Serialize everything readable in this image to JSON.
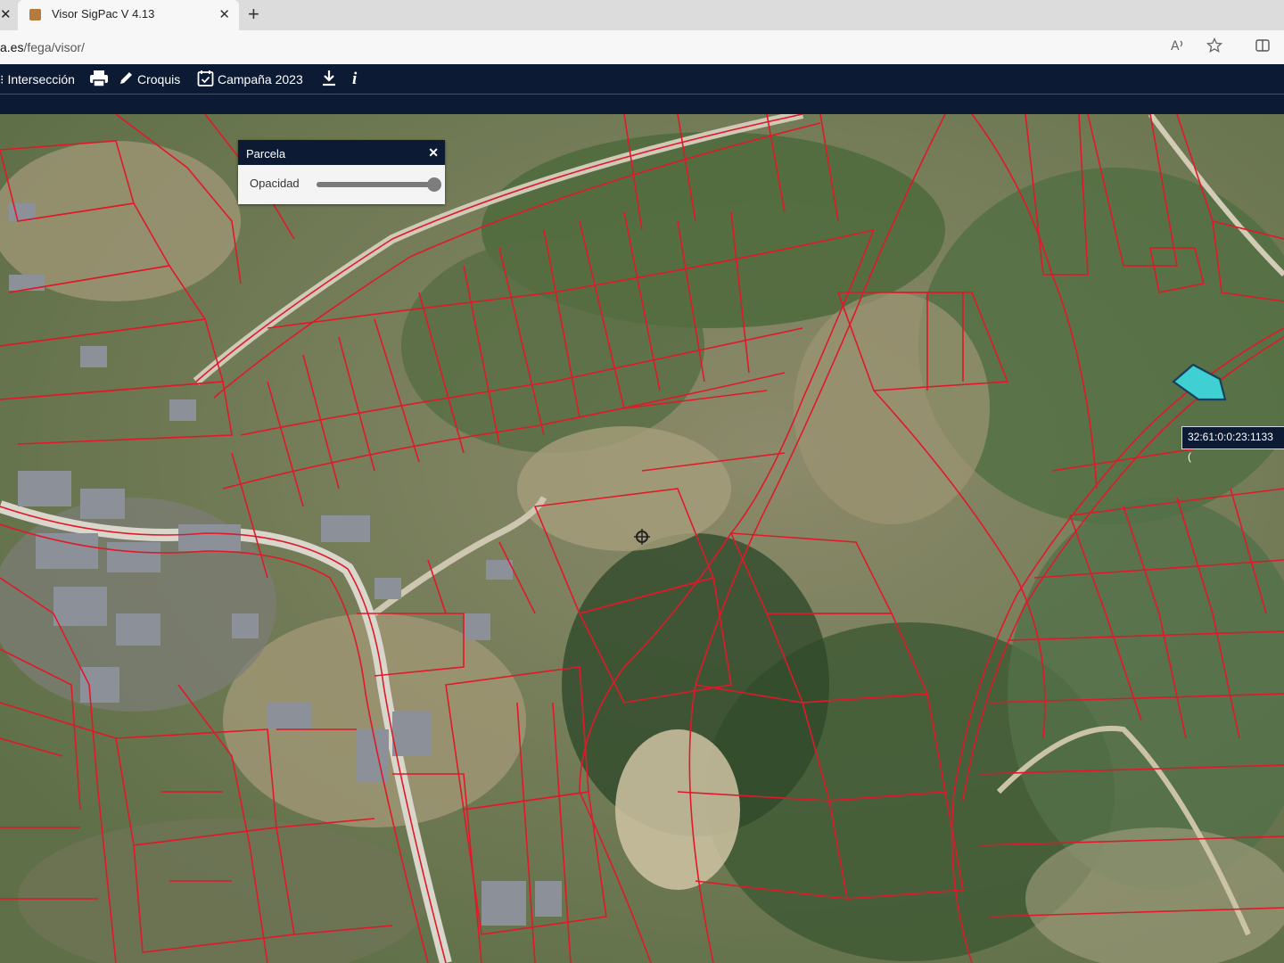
{
  "browser": {
    "tab_title": "Visor SigPac V 4.13",
    "tab_close": "✕",
    "new_tab": "+",
    "url_host": "a.es",
    "url_path": "/fega/visor/",
    "icons": [
      "read-aloud-icon",
      "favorite-star-icon",
      "split-screen-icon"
    ]
  },
  "toolbar": {
    "interseccion_label": "Intersección",
    "croquis_label": "Croquis",
    "campana_label": "Campaña 2023",
    "info_label": "i"
  },
  "panel": {
    "title": "Parcela",
    "opacity_label": "Opacidad",
    "opacity_value": 1.0
  },
  "map": {
    "selected_parcel_label": "32:61:0:0:23:1133 (",
    "colors": {
      "parcel_border": "#e0192a",
      "selected_parcel": "#3fd0d4",
      "toolbar_bg": "#0c1a33"
    }
  }
}
